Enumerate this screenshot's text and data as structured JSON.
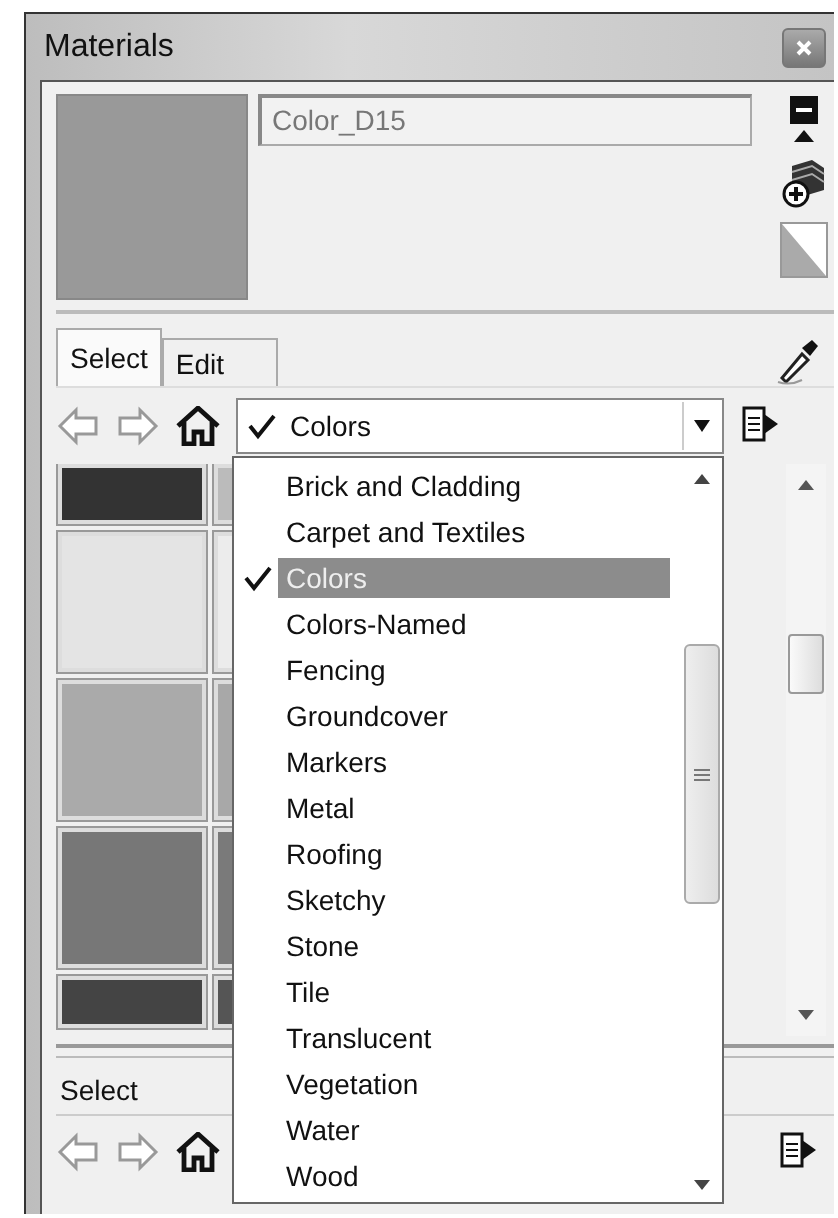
{
  "window": {
    "title": "Materials"
  },
  "material": {
    "name": "Color_D15"
  },
  "tabs": [
    {
      "label": "Select",
      "selected": true
    },
    {
      "label": "Edit",
      "selected": false
    }
  ],
  "library": {
    "value": "Colors"
  },
  "swatches": [
    {
      "color": "#333333"
    },
    {
      "color": "#bbbbbb"
    },
    {
      "color": "#e4e4e4"
    },
    {
      "color": "#ececec"
    },
    {
      "color": "#aaaaaa"
    },
    {
      "color": "#a8a8a8"
    },
    {
      "color": "#777777"
    },
    {
      "color": "#7a7a7a"
    },
    {
      "color": "#444444"
    },
    {
      "color": "#555555"
    }
  ],
  "dropdown": {
    "items": [
      {
        "label": "Brick and Cladding",
        "selected": false
      },
      {
        "label": "Carpet and Textiles",
        "selected": false
      },
      {
        "label": "Colors",
        "selected": true
      },
      {
        "label": "Colors-Named",
        "selected": false
      },
      {
        "label": "Fencing",
        "selected": false
      },
      {
        "label": "Groundcover",
        "selected": false
      },
      {
        "label": "Markers",
        "selected": false
      },
      {
        "label": "Metal",
        "selected": false
      },
      {
        "label": "Roofing",
        "selected": false
      },
      {
        "label": "Sketchy",
        "selected": false
      },
      {
        "label": "Stone",
        "selected": false
      },
      {
        "label": "Tile",
        "selected": false
      },
      {
        "label": "Translucent",
        "selected": false
      },
      {
        "label": "Vegetation",
        "selected": false
      },
      {
        "label": "Water",
        "selected": false
      },
      {
        "label": "Wood",
        "selected": false
      }
    ]
  },
  "lower_pane": {
    "title": "Select"
  }
}
